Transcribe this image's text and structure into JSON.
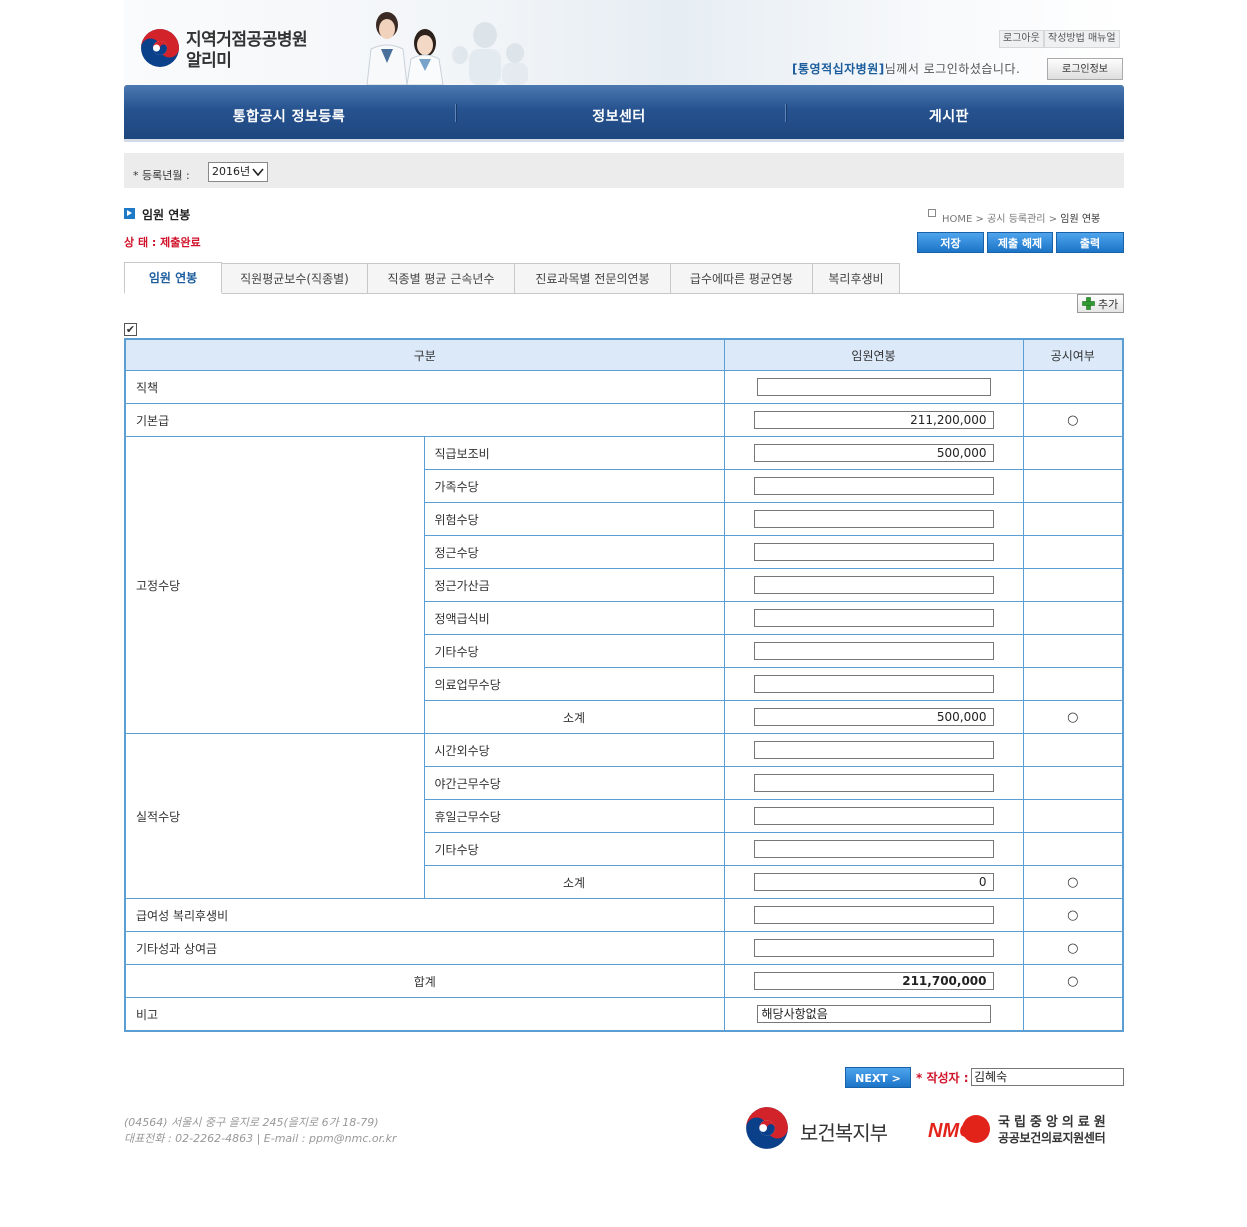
{
  "header": {
    "logo_line1": "지역거점공공병원",
    "logo_line2": "알리미",
    "logout": "로그아웃",
    "manual": "작성방법 매뉴얼",
    "hospital": "[통영적십자병원]",
    "welcome_suffix": "님께서 로그인하셨습니다.",
    "login_info": "로그인정보"
  },
  "nav": [
    "통합공시 정보등록",
    "정보센터",
    "게시판"
  ],
  "year": {
    "label": "* 등록년월 :",
    "selected": "2016년"
  },
  "page": {
    "title": "임원 연봉",
    "breadcrumb": [
      "HOME",
      ">",
      "공시 등록관리",
      ">",
      "임원 연봉"
    ],
    "status": "상 태 : 제출완료"
  },
  "actions": {
    "save": "저장",
    "unsubmit": "제출 해제",
    "print": "출력"
  },
  "tabs": [
    "임원 연봉",
    "직원평균보수(직종별)",
    "직종별 평균 근속년수",
    "진료과목별 전문의연봉",
    "급수에따른 평균연봉",
    "복리후생비"
  ],
  "add_button": "추가",
  "checkbox_mark": "✔",
  "table": {
    "headers": [
      "구분",
      "임원연봉",
      "공시여부"
    ],
    "rows": {
      "position": {
        "label": "직책",
        "value": ""
      },
      "base_pay": {
        "label": "기본급",
        "value": "211,200,000",
        "disclosed": "○"
      },
      "fixed_group": "고정수당",
      "fixed": [
        {
          "label": "직급보조비",
          "value": "500,000"
        },
        {
          "label": "가족수당",
          "value": ""
        },
        {
          "label": "위험수당",
          "value": ""
        },
        {
          "label": "정근수당",
          "value": ""
        },
        {
          "label": "정근가산금",
          "value": ""
        },
        {
          "label": "정액급식비",
          "value": ""
        },
        {
          "label": "기타수당",
          "value": ""
        },
        {
          "label": "의료업무수당",
          "value": ""
        }
      ],
      "fixed_subtotal": {
        "label": "소계",
        "value": "500,000",
        "disclosed": "○"
      },
      "perf_group": "실적수당",
      "perf": [
        {
          "label": "시간외수당",
          "value": ""
        },
        {
          "label": "야간근무수당",
          "value": ""
        },
        {
          "label": "휴일근무수당",
          "value": ""
        },
        {
          "label": "기타수당",
          "value": ""
        }
      ],
      "perf_subtotal": {
        "label": "소계",
        "value": "0",
        "disclosed": "○"
      },
      "welfare": {
        "label": "급여성 복리후생비",
        "value": "",
        "disclosed": "○"
      },
      "bonus": {
        "label": "기타성과 상여금",
        "value": "",
        "disclosed": "○"
      },
      "total": {
        "label": "합계",
        "value": "211,700,000",
        "disclosed": "○"
      },
      "remarks": {
        "label": "비고",
        "value": "해당사항없음"
      }
    }
  },
  "footer": {
    "next": "NEXT >",
    "author_label": "* 작성자 :",
    "author": "김혜숙",
    "address": "(04564) 서울시 중구 을지로 245(을지로 6가 18-79)",
    "contact": "대표전화 : 02-2262-4863 | E-mail : ppm@nmc.or.kr",
    "ministry": "보건복지부",
    "nmc_logo": "NMC",
    "nmc_name": "국립중앙의료원",
    "nmc_sub": "공공보건의료지원센터"
  }
}
